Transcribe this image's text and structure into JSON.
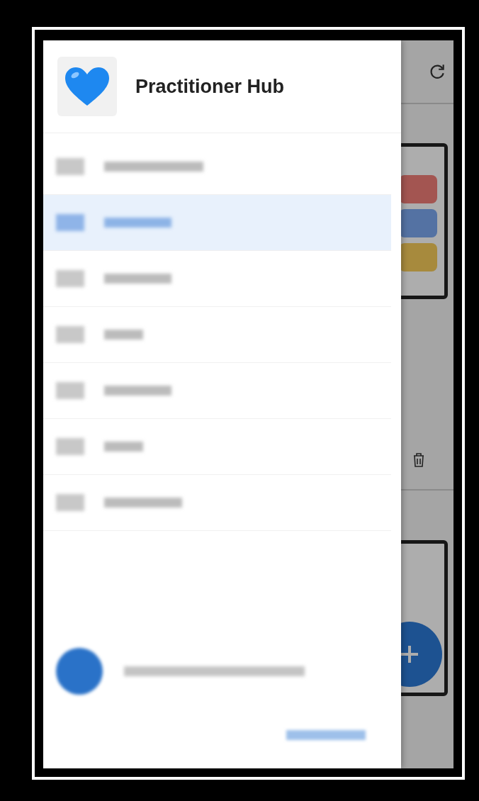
{
  "drawer": {
    "title": "Practitioner Hub"
  },
  "nav_items": [
    {
      "selected": false
    },
    {
      "selected": true
    },
    {
      "selected": false
    },
    {
      "selected": false
    },
    {
      "selected": false
    },
    {
      "selected": false
    },
    {
      "selected": false
    }
  ]
}
